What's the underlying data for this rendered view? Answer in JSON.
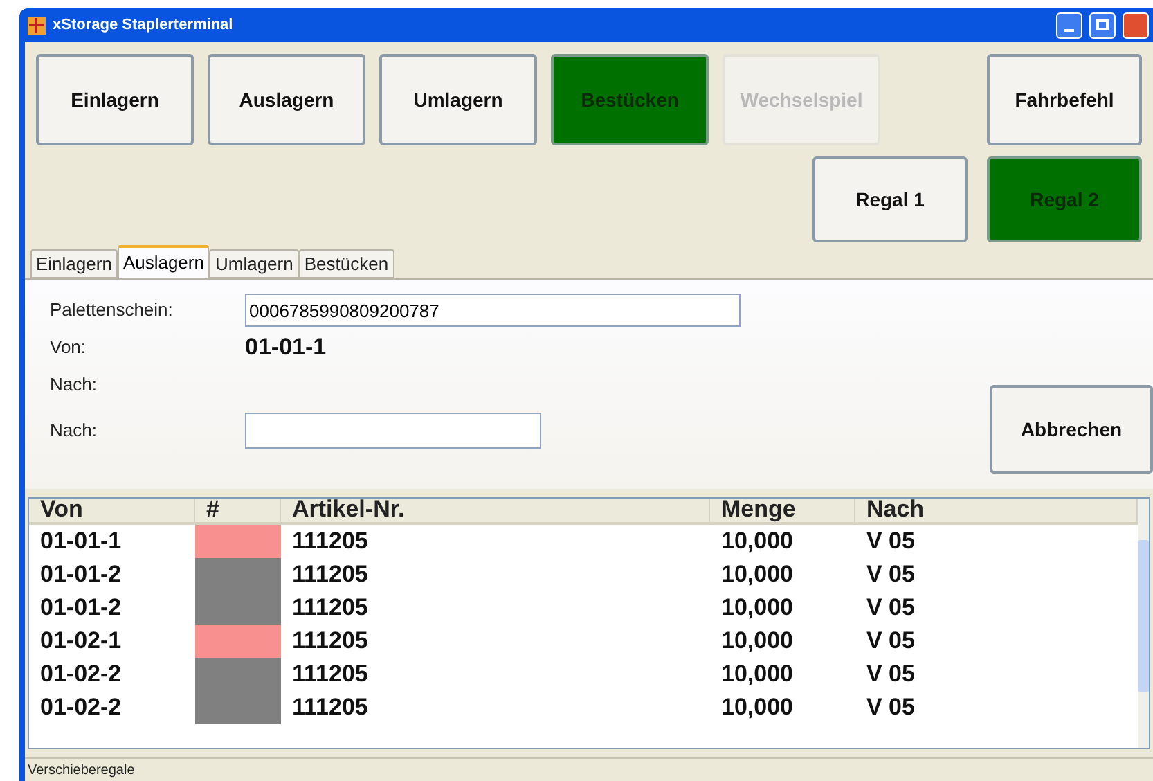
{
  "window": {
    "title": "xStorage Staplerterminal"
  },
  "top_buttons": [
    {
      "label": "Einlagern",
      "selected": false,
      "disabled": false
    },
    {
      "label": "Auslagern",
      "selected": false,
      "disabled": false
    },
    {
      "label": "Umlagern",
      "selected": false,
      "disabled": false
    },
    {
      "label": "Bestücken",
      "selected": true,
      "disabled": false
    },
    {
      "label": "Wechselspiel",
      "selected": false,
      "disabled": true
    }
  ],
  "fahrbefehl": {
    "label": "Fahrbefehl",
    "selected": false,
    "disabled": false
  },
  "regal_buttons": [
    {
      "label": "Regal 1",
      "selected": false,
      "disabled": false
    },
    {
      "label": "Regal 2",
      "selected": true,
      "disabled": false
    }
  ],
  "tabs": [
    {
      "label": "Einlagern",
      "selected": false
    },
    {
      "label": "Auslagern",
      "selected": true
    },
    {
      "label": "Umlagern",
      "selected": false
    },
    {
      "label": "Bestücken",
      "selected": false
    }
  ],
  "form": {
    "palettenschein_label": "Palettenschein:",
    "palettenschein_value": "0006785990809200787",
    "von_label": "Von:",
    "von_value": "01-01-1",
    "nach_label": "Nach:",
    "nach_input_label": "Nach:",
    "cancel": "Abbrechen"
  },
  "table": {
    "columns": [
      "Von",
      "#",
      "Artikel-Nr.",
      "Menge",
      "Nach"
    ],
    "rows": [
      {
        "von": "01-01-1",
        "color": "#f89090",
        "artikel": "111205",
        "menge": "10,000",
        "nach": "V 05"
      },
      {
        "von": "01-01-2",
        "color": "#808080",
        "artikel": "111205",
        "menge": "10,000",
        "nach": "V 05"
      },
      {
        "von": "01-01-2",
        "color": "#808080",
        "artikel": "111205",
        "menge": "10,000",
        "nach": "V 05"
      },
      {
        "von": "01-02-1",
        "color": "#f89090",
        "artikel": "111205",
        "menge": "10,000",
        "nach": "V 05"
      },
      {
        "von": "01-02-2",
        "color": "#808080",
        "artikel": "111205",
        "menge": "10,000",
        "nach": "V 05"
      },
      {
        "von": "01-02-2",
        "color": "#808080",
        "artikel": "111205",
        "menge": "10,000",
        "nach": "V 05"
      }
    ]
  },
  "status_bar": "Verschieberegale"
}
